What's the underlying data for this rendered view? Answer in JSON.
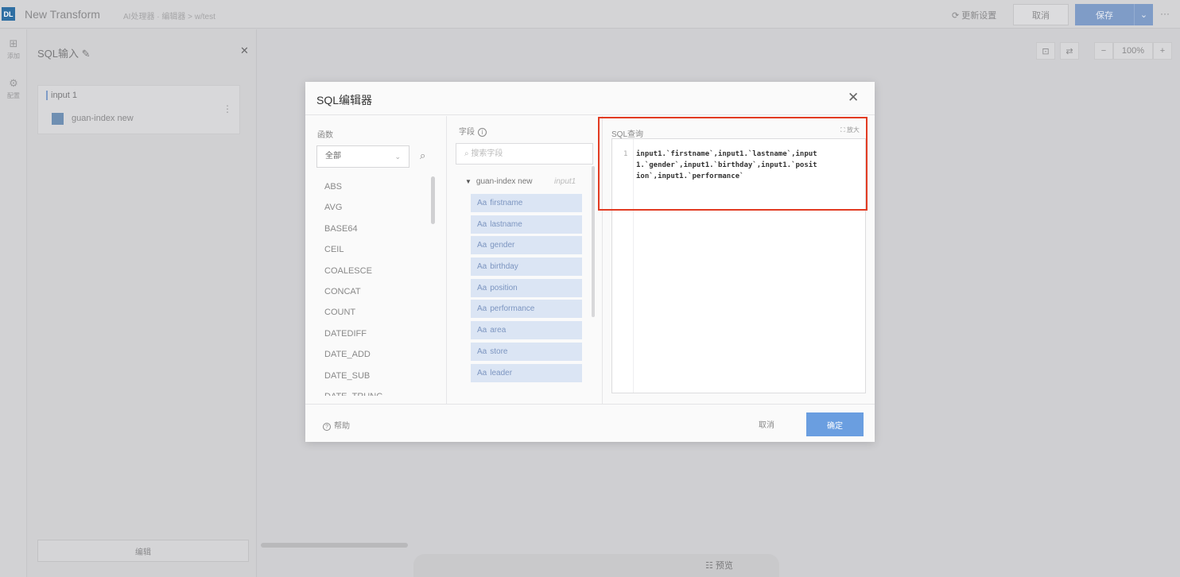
{
  "app": {
    "logo": "DL",
    "title": "New Transform",
    "breadcrumb": "AI处理器 · 编辑器 > w/test",
    "settings_label": "更新设置",
    "cancel_label": "取消",
    "save_label": "保存",
    "save_dropdown": "⌄",
    "more": "···"
  },
  "rail": [
    {
      "icon": "add-node-icon",
      "glyph": "⊞",
      "label": "添加"
    },
    {
      "icon": "settings-icon",
      "glyph": "⚙",
      "label": "配置"
    }
  ],
  "left_panel": {
    "title": "SQL输入 ✎",
    "close": "✕",
    "input_name": "input 1",
    "dataset": "guan-index new",
    "menu": "⋮",
    "edit_button": "编辑"
  },
  "canvas_tools": {
    "zoom_out": "−",
    "zoom": "100%",
    "zoom_in": "+",
    "icon1": "⊡",
    "icon2": "⇄"
  },
  "bottom_bar": {
    "label": "☷ 预览"
  },
  "modal": {
    "title": "SQL编辑器",
    "close": "✕",
    "functions": {
      "header": "函数",
      "category": "全部",
      "items": [
        "ABS",
        "AVG",
        "BASE64",
        "CEIL",
        "COALESCE",
        "CONCAT",
        "COUNT",
        "DATEDIFF",
        "DATE_ADD",
        "DATE_SUB",
        "DATE_TRUNC"
      ]
    },
    "fields": {
      "header": "字段",
      "search_placeholder": "搜索字段",
      "dataset": "guan-index new",
      "alias": "input1",
      "items": [
        "firstname",
        "lastname",
        "gender",
        "birthday",
        "position",
        "performance",
        "area",
        "store",
        "leader"
      ]
    },
    "sql": {
      "header": "SQL查询",
      "fullscreen": "⛶ 放大",
      "line_number": "1",
      "code": "input1.`firstname`,input1.`lastname`,input1.`gender`,input1.`birthday`,input1.`position`,input1.`performance`"
    },
    "footer": {
      "help": "帮助",
      "cancel": "取消",
      "ok": "确定"
    }
  },
  "colors": {
    "accent": "#6a9ee0",
    "highlight": "#e23b22",
    "field_bg": "#dbe5f4"
  }
}
